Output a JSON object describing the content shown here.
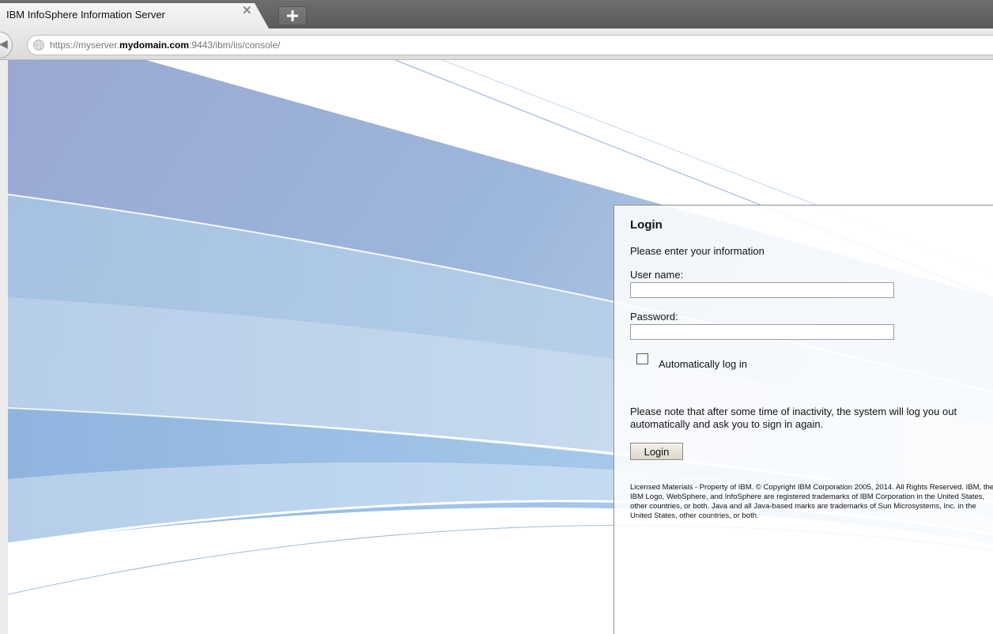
{
  "browser": {
    "tab_title": "IBM InfoSphere Information Server",
    "close_glyph": "✕",
    "back_glyph": "◀",
    "url": {
      "prefix": "https://myserver.",
      "domain": "mydomain.com",
      "suffix": ":9443/ibm/iis/console/"
    }
  },
  "login": {
    "title": "Login",
    "subtitle": "Please enter your information",
    "username_label": "User name:",
    "username_value": "",
    "password_label": "Password:",
    "password_value": "",
    "auto_login_label": "Automatically log in",
    "auto_login_checked": false,
    "inactivity_note": "Please note that after some time of inactivity, the system will log you out automatically and ask you to sign in again.",
    "button_label": "Login",
    "copyright": "Licensed Materials - Property of IBM. © Copyright IBM Corporation 2005, 2014. All Rights Reserved. IBM, the IBM Logo, WebSphere, and InfoSphere are registered trademarks of IBM Corporation in the United States, other countries, or both. Java and all Java-based marks are trademarks of Sun Microsystems, Inc. in the United States, other countries, or both."
  },
  "colors": {
    "tab_strip": "#5f5f5f",
    "background_blue": "#9fb7da",
    "background_light_blue": "#c9dbee",
    "panel_border": "#8f8f8f",
    "button_face": "#e6e1d6"
  },
  "icons": [
    "close-icon",
    "plus-icon",
    "back-arrow-icon",
    "globe-icon"
  ]
}
